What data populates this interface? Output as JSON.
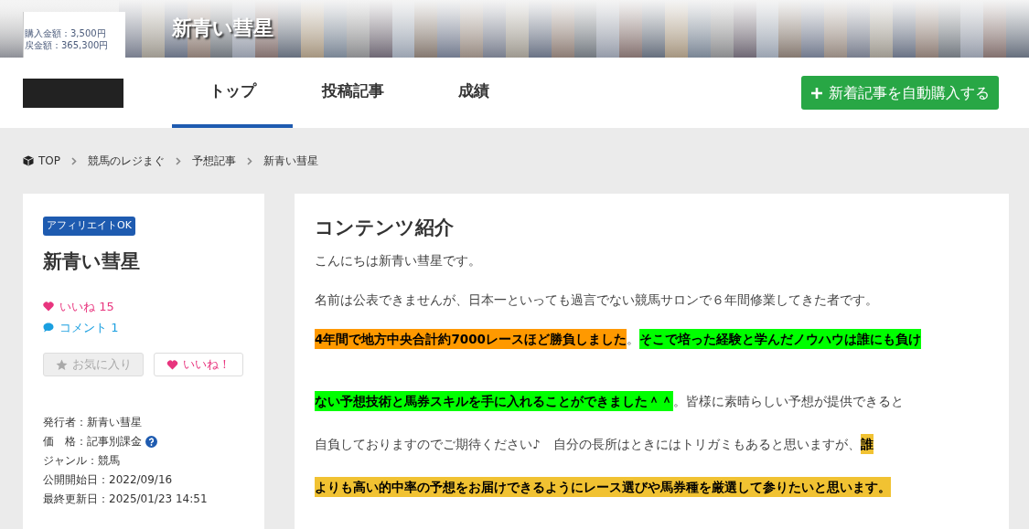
{
  "banner": {
    "title": "新青い彗星",
    "inset_lines": [
      "購入金額：3,500円",
      "戻金額：365,300円"
    ]
  },
  "nav": {
    "tabs": [
      {
        "label": "トップ",
        "selected": true
      },
      {
        "label": "投稿記事",
        "selected": false
      },
      {
        "label": "成績",
        "selected": false
      }
    ],
    "action": "新着記事を自動購入する"
  },
  "breadcrumb": [
    "TOP",
    "競馬のレジまぐ",
    "予想記事",
    "新青い彗星"
  ],
  "profile": {
    "badge": "アフィリエイトOK",
    "name": "新青い彗星",
    "likes": "いいね 15",
    "comments": "コメント 1",
    "favorite_button": {
      "label": "お気に入り",
      "disabled": true
    },
    "like_button": "いいね！",
    "info": [
      {
        "text": "発行者：新青い彗星",
        "help": false
      },
      {
        "text": "価　格：記事別課金",
        "help": true
      },
      {
        "text": "ジャンル：競馬",
        "help": false
      },
      {
        "text": "公開開始日：2022/09/16",
        "help": false
      },
      {
        "text": "最終更新日：2025/01/23 14:51",
        "help": false
      }
    ]
  },
  "content": {
    "heading": "コンテンツ紹介",
    "paragraphs": [
      "こんにちは新青い彗星です。",
      "名前は公表できませんが、日本一といっても過言でない競馬サロンで６年間修業してきた者です。"
    ],
    "lines": [
      [
        {
          "text": "4年間で地方中央合計約7000レースほど勝負しました",
          "color": "#ff9900"
        },
        {
          "text": "。"
        },
        {
          "text": "そこで培った経験と学んだノウハウは誰にも負け",
          "color": "#00ff00"
        }
      ],
      [
        {
          "text": "ない予想技術と馬券スキルを手に入れることができました＾＾",
          "color": "#00ff00"
        },
        {
          "text": "。皆様に素晴らしい予想が提供できると"
        }
      ],
      [
        {
          "text": "自負しておりますのでご期待ください♪　自分の長所はときにはトリガミもあると思いますが、"
        },
        {
          "text": "誰",
          "color": "#f1c232"
        }
      ],
      [
        {
          "text": "よりも高い的中率の予想をお届けできるようにレース選びや馬券種を厳選して参りたいと思います。",
          "color": "#f1c232"
        }
      ]
    ]
  }
}
